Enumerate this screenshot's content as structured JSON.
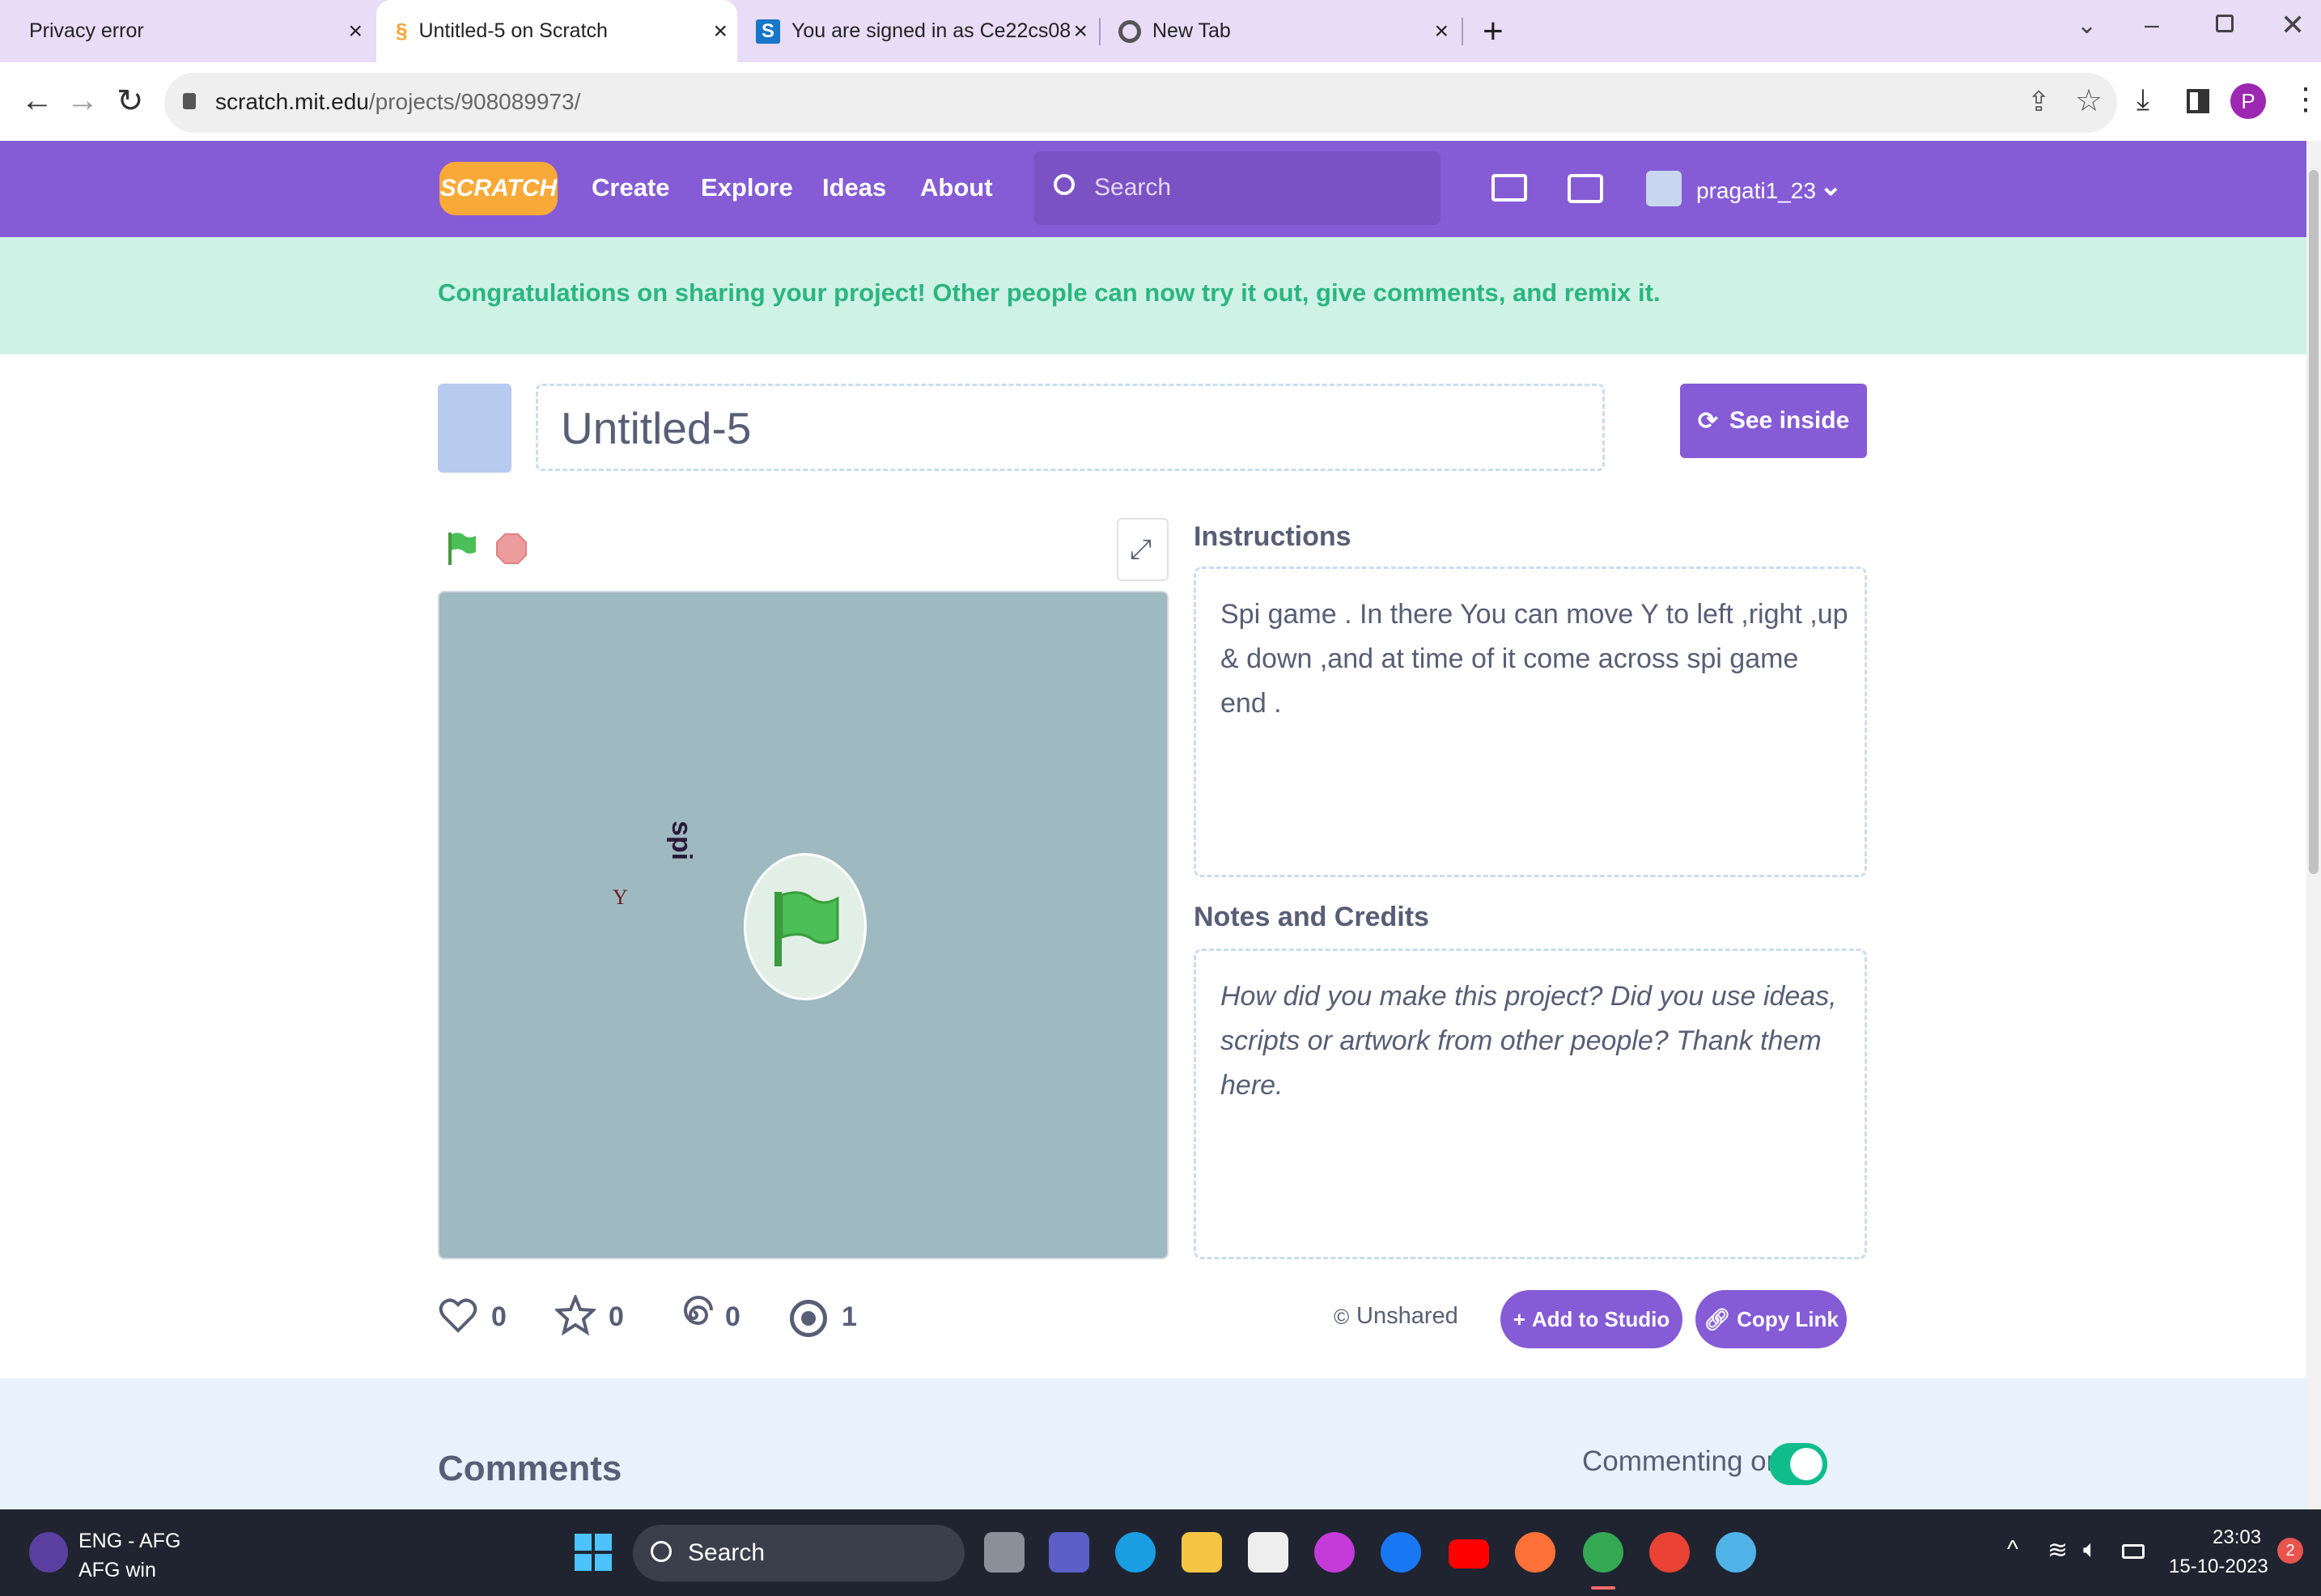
{
  "browser": {
    "tabs": [
      {
        "title": "Privacy error"
      },
      {
        "title": "Untitled-5 on Scratch"
      },
      {
        "title": "You are signed in as Ce22cs08"
      },
      {
        "title": "New Tab"
      }
    ],
    "url_domain": "scratch.mit.edu",
    "url_path": "/projects/908089973/",
    "profile_initial": "P"
  },
  "scratch_nav": {
    "logo": "SCRATCH",
    "links": [
      "Create",
      "Explore",
      "Ideas",
      "About"
    ],
    "search_placeholder": "Search",
    "username": "pragati1_23"
  },
  "banner": {
    "text": "Congratulations on sharing your project! Other people can now try it out, give comments, and remix it."
  },
  "project": {
    "title": "Untitled-5",
    "see_inside": "See inside",
    "stage": {
      "sprite_label": "Y",
      "sprite_text": "spi"
    },
    "instructions_heading": "Instructions",
    "instructions": "Spi game . In there You can move Y to left ,right ,up & down ,and at time of it come across spi game end .",
    "notes_heading": "Notes and Credits",
    "notes_placeholder": "How did you make this project? Did you use ideas, scripts or artwork from other people? Thank them here.",
    "stats": {
      "loves": "0",
      "favorites": "0",
      "remixes": "0",
      "views": "1"
    },
    "unshared": "Unshared",
    "add_to_studio": "Add to Studio",
    "copy_link": "Copy Link"
  },
  "comments": {
    "heading": "Comments",
    "commenting_label": "Commenting on",
    "commenting_enabled": true
  },
  "taskbar": {
    "lang": "ENG - AFG",
    "lang_sub": "AFG win",
    "search": "Search",
    "time": "23:03",
    "date": "15-10-2023",
    "notification_count": "2"
  },
  "colors": {
    "scratch_purple": "#855cd6",
    "banner_bg": "#cff2e6",
    "banner_text": "#2bb581",
    "stage_bg": "#9eb9bf",
    "toggle_on": "#0fbd8c"
  }
}
